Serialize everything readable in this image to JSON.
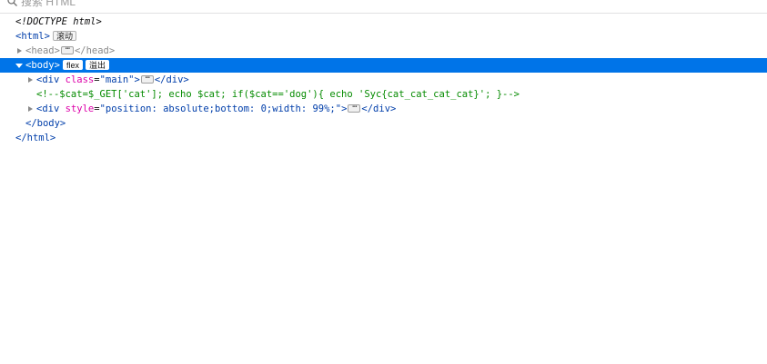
{
  "search": {
    "placeholder": "搜索 HTML"
  },
  "tree": {
    "doctype": "<!DOCTYPE html>",
    "html_open": "<html>",
    "html_badge": "滚动",
    "head_open": "<head>",
    "head_close": "</head>",
    "ellipsis": "⋯",
    "body_open": "<body>",
    "body_badge_flex": "flex",
    "body_badge_overflow": "溢出",
    "div_main_open": "<div",
    "div_main_attr_name": "class",
    "div_main_attr_value": "\"main\"",
    "div_main_close_bracket": ">",
    "div_close": "</div>",
    "comment": "<!--$cat=$_GET['cat']; echo $cat; if($cat=='dog'){ echo 'Syc{cat_cat_cat_cat}'; }-->",
    "div_style_open": "<div",
    "div_style_attr_name": "style",
    "div_style_attr_value": "\"position: absolute;bottom: 0;width: 99%;\"",
    "div_style_close_bracket": ">",
    "body_close": "</body>",
    "html_close": "</html>"
  },
  "colors": {
    "selection": "#0074e8",
    "tag": "#003eaa",
    "comment": "#058b00"
  }
}
